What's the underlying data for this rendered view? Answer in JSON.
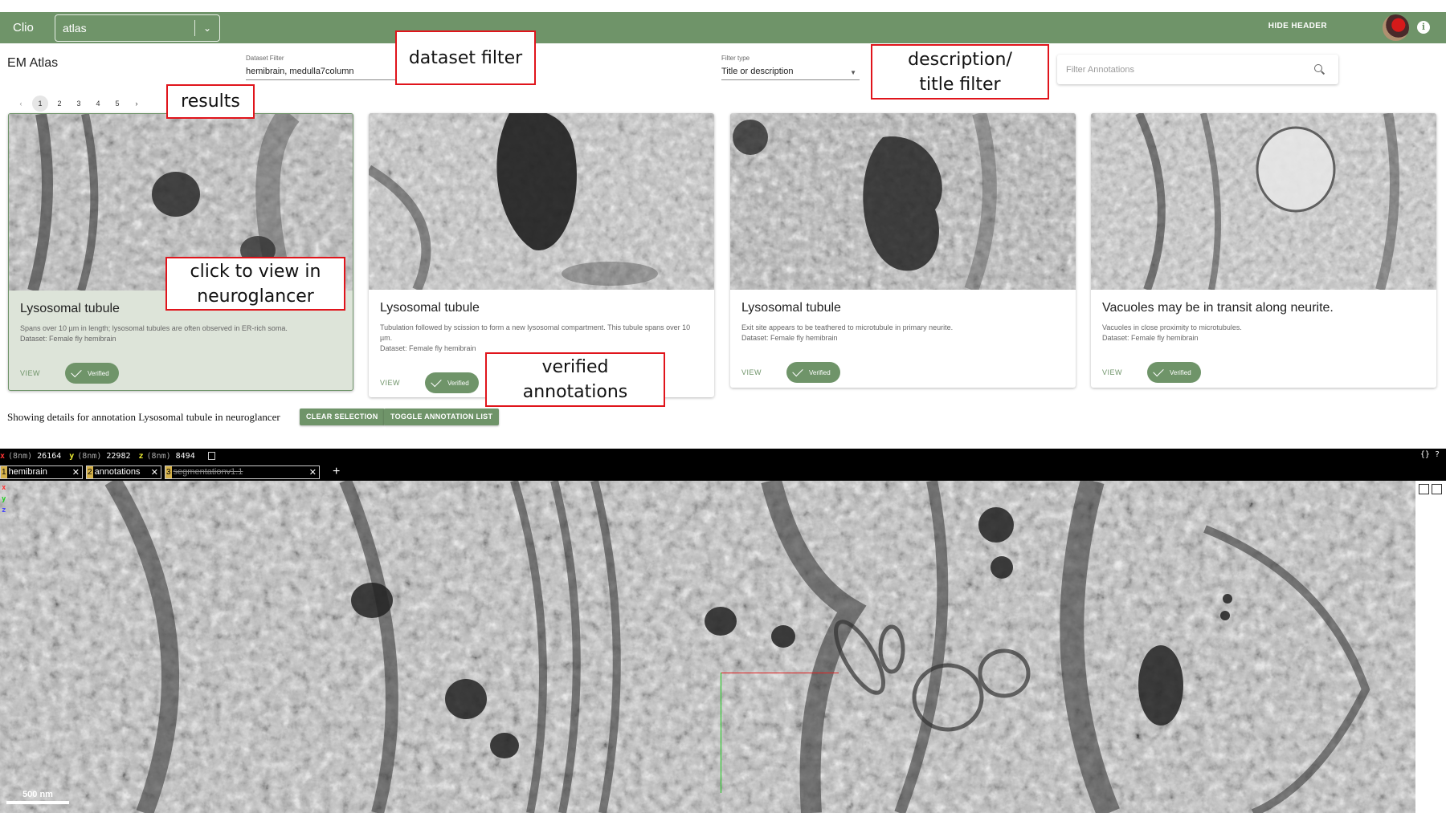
{
  "header": {
    "brand": "Clio",
    "dataset_select": "atlas",
    "hide_header": "HIDE HEADER"
  },
  "page_title": "EM Atlas",
  "filters": {
    "dataset_filter_label": "Dataset Filter",
    "dataset_filter_value": "hemibrain, medulla7column",
    "filter_type_label": "Filter type",
    "filter_type_value": "Title or description",
    "search_placeholder": "Filter Annotations"
  },
  "pager": [
    "1",
    "2",
    "3",
    "4",
    "5"
  ],
  "cards": [
    {
      "title": "Lysosomal tubule",
      "description": "Spans over 10 µm in length; lysosomal tubules are often observed in ER-rich soma.",
      "dataset": "Dataset: Female fly hemibrain",
      "view": "VIEW",
      "verified": "Verified",
      "selected": true
    },
    {
      "title": "Lysosomal tubule",
      "description": "Tubulation followed by scission to form a new lysosomal compartment. This tubule spans over 10 µm.",
      "dataset": "Dataset: Female fly hemibrain",
      "view": "VIEW",
      "verified": "Verified",
      "selected": false
    },
    {
      "title": "Lysosomal tubule",
      "description": "Exit site appears to be teathered to microtubule in primary neurite.",
      "dataset": "Dataset: Female fly hemibrain",
      "view": "VIEW",
      "verified": "Verified",
      "selected": false
    },
    {
      "title": "Vacuoles may be in transit along neurite.",
      "description": "Vacuoles in close proximity to microtubules.",
      "dataset": "Dataset: Female fly hemibrain",
      "view": "VIEW",
      "verified": "Verified",
      "selected": false
    }
  ],
  "details_line": "Showing details for annotation Lysosomal tubule in neuroglancer",
  "buttons": {
    "clear_selection": "CLEAR SELECTION",
    "toggle_annotation_list": "TOGGLE ANNOTATION LIST"
  },
  "neuroglancer": {
    "coords": [
      {
        "axis": "x",
        "unit": "(8nm)",
        "value": "26164"
      },
      {
        "axis": "y",
        "unit": "(8nm)",
        "value": "22982"
      },
      {
        "axis": "z",
        "unit": "(8nm)",
        "value": "8494"
      }
    ],
    "top_right": "{}  ?",
    "layers": [
      {
        "index": "1",
        "name": "hemibrain",
        "visible": true
      },
      {
        "index": "2",
        "name": "annotations",
        "visible": true
      },
      {
        "index": "3",
        "name": "segmentationv1.1",
        "visible": false
      }
    ],
    "scale_bar": "500 nm",
    "axis_labels": [
      "x",
      "y",
      "z"
    ]
  },
  "callouts": {
    "dataset_filter": "dataset filter",
    "results": "results",
    "desc_filter_line1": "description/",
    "desc_filter_line2": "title filter",
    "click_line1": "click to view in",
    "click_line2": "neuroglancer",
    "verified_line1": "verified",
    "verified_line2": "annotations"
  },
  "colors": {
    "header_green": "#6f9469",
    "selected_card": "#dde4d9",
    "callout_red": "#e0141b"
  }
}
